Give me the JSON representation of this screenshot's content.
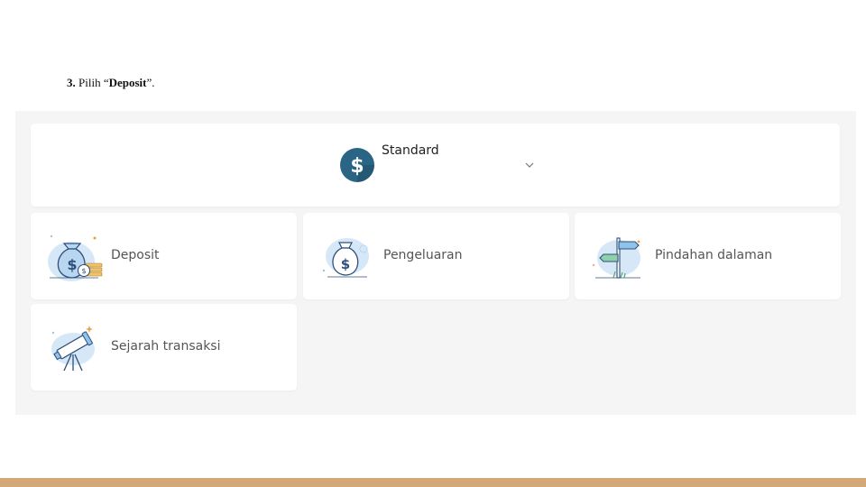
{
  "instruction": {
    "number": "3.",
    "prefix": " Pilih “",
    "target": "Deposit",
    "suffix": "”."
  },
  "account": {
    "name": "Standard",
    "icon": "dollar-coin-icon",
    "dropdown_icon": "chevron-down-icon",
    "coin_color": "#2b6585"
  },
  "actions": [
    {
      "label": "Deposit",
      "icon": "money-bag-coins-icon"
    },
    {
      "label": "Pengeluaran",
      "icon": "money-bag-icon"
    },
    {
      "label": "Pindahan dalaman",
      "icon": "signpost-icon"
    },
    {
      "label": "Sejarah transaksi",
      "icon": "telescope-icon"
    }
  ],
  "colors": {
    "panel_bg": "#f5f5f5",
    "card_bg": "#ffffff",
    "illustration_blue": "#d6e8f8",
    "illustration_stroke": "#2f4f7a",
    "accent_gold": "#e6a33a",
    "footer_bar": "#d4a878"
  }
}
